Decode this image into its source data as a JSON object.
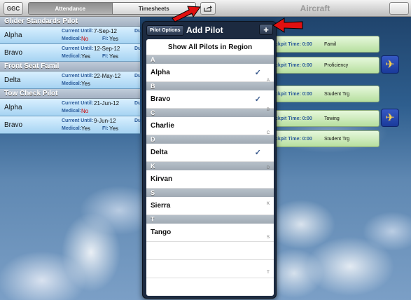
{
  "topbar": {
    "ggc": "GGC",
    "tabs": [
      "Attendance",
      "Timesheets"
    ],
    "title": "Aircraft"
  },
  "left": {
    "sections": [
      {
        "title": "Glider Standards Pilot",
        "rows": [
          {
            "name": "Alpha",
            "current_label": "Current Until:",
            "current": "7-Sep-12",
            "medical_label": "Medical:",
            "medical": "No",
            "fi_label": "FI:",
            "fi": "Yes",
            "due": "Du"
          },
          {
            "name": "Bravo",
            "current_label": "Current Until:",
            "current": "12-Sep-12",
            "medical_label": "Medical:",
            "medical": "Yes",
            "fi_label": "FI:",
            "fi": "Yes",
            "due": "Du"
          }
        ]
      },
      {
        "title": "Front Seat Famil",
        "rows": [
          {
            "name": "Delta",
            "current_label": "Current Until:",
            "current": "22-May-12",
            "medical_label": "Medical:",
            "medical": "Yes",
            "fi_label": "",
            "fi": "",
            "due": "Du"
          }
        ]
      },
      {
        "title": "Tow Check Pilot",
        "rows": [
          {
            "name": "Alpha",
            "current_label": "Current Until:",
            "current": "21-Jun-12",
            "medical_label": "Medical:",
            "medical": "No",
            "fi_label": "",
            "fi": "",
            "due": "Du"
          },
          {
            "name": "Bravo",
            "current_label": "Current Until:",
            "current": "9-Jun-12",
            "medical_label": "Medical:",
            "medical": "Yes",
            "fi_label": "FI:",
            "fi": "Yes",
            "due": "Du"
          }
        ]
      }
    ]
  },
  "right": {
    "rows": [
      {
        "ck": "ckpit Time:",
        "time": "0:00",
        "text": "Famil",
        "plane": false
      },
      {
        "ck": "ckpit Time:",
        "time": "0:00",
        "text": "Proficiency",
        "plane": true
      },
      {
        "ck": "ckpit Time:",
        "time": "0:00",
        "text": "Student Trg",
        "plane": false
      },
      {
        "ck": "ckpit Time:",
        "time": "0:00",
        "text": "Towing",
        "plane": true
      },
      {
        "ck": "ckpit Time:",
        "time": "0:00",
        "text": "Student Trg",
        "plane": false
      }
    ]
  },
  "popover": {
    "options_label": "Pilot Options",
    "title": "Add Pilot",
    "plus": "+",
    "show_all": "Show All Pilots in Region",
    "groups": [
      {
        "letter": "A",
        "name": "Alpha",
        "checked": true
      },
      {
        "letter": "B",
        "name": "Bravo",
        "checked": true
      },
      {
        "letter": "C",
        "name": "Charlie",
        "checked": false
      },
      {
        "letter": "D",
        "name": "Delta",
        "checked": true
      },
      {
        "letter": "K",
        "name": "Kirvan",
        "checked": false
      },
      {
        "letter": "S",
        "name": "Sierra",
        "checked": false
      },
      {
        "letter": "T",
        "name": "Tango",
        "checked": false
      }
    ],
    "index": [
      "A",
      "B",
      "C",
      "D",
      "K",
      "S",
      "T"
    ]
  },
  "colors": {
    "arrow": "#e01010",
    "plane_bg": "#2448b0",
    "row_green": "#cfeebd",
    "row_blue": "#bfe2fa"
  }
}
